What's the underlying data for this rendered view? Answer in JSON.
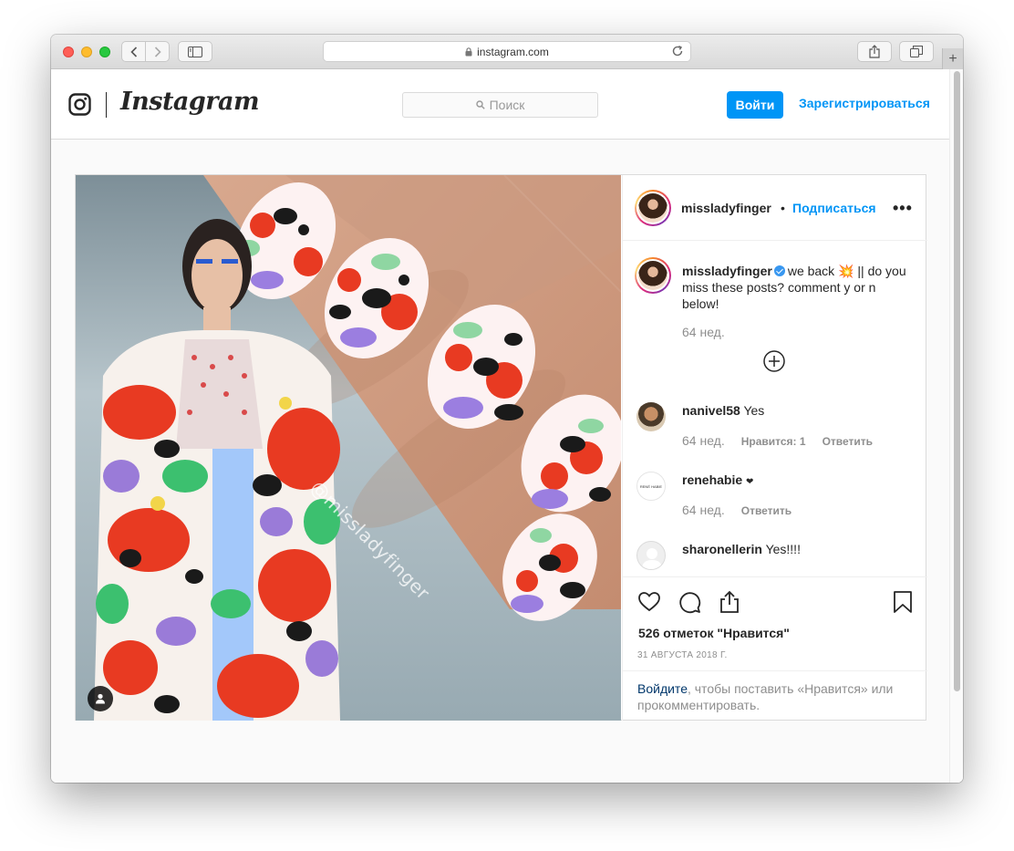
{
  "browser": {
    "url": "instagram.com",
    "new_tab_symbol": "+"
  },
  "header": {
    "wordmark": "Instagram",
    "search_placeholder": "Поиск",
    "login_label": "Войти",
    "signup_label": "Зарегистрироваться"
  },
  "post": {
    "watermark": "@missladyfinger",
    "author": "missladyfinger",
    "dot": "•",
    "follow_label": "Подписаться",
    "more_label": "•••",
    "caption": {
      "username": "missladyfinger",
      "text_before_emoji": "we back",
      "emoji": "💥",
      "text_after_emoji": "|| do you miss these posts? comment y or n below!",
      "time": "64 нед."
    },
    "comments": [
      {
        "username": "nanivel58",
        "text": "Yes",
        "time": "64 нед.",
        "likes_label": "Нравится: 1",
        "reply_label": "Ответить"
      },
      {
        "username": "renehabie",
        "text": "❤",
        "time": "64 нед.",
        "reply_label": "Ответить",
        "avatar_text": "RENÉ HABIE"
      },
      {
        "username": "sharonellerin",
        "text": "Yes!!!!"
      }
    ],
    "likes": "526 отметок \"Нравится\"",
    "date": "31 АВГУСТА 2018 Г.",
    "login_prompt": {
      "link": "Войдите",
      "rest": ", чтобы поставить «Нравится» или прокомментировать."
    }
  },
  "colors": {
    "accent": "#0095f6",
    "text": "#262626",
    "muted": "#8e8e8e",
    "border": "#dbdbdb"
  }
}
